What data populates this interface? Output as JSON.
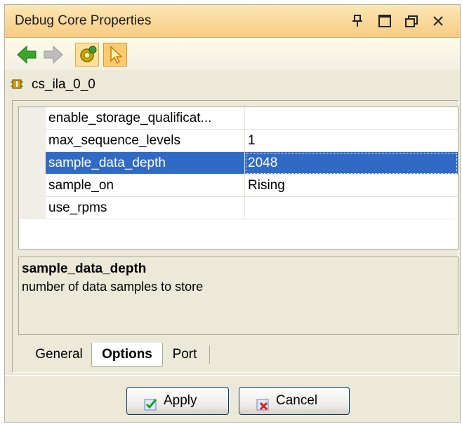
{
  "window": {
    "title": "Debug Core Properties"
  },
  "core": {
    "name": "cs_ila_0_0"
  },
  "properties": [
    {
      "name": "enable_storage_qualificat...",
      "value": "",
      "type": "checkbox",
      "checked": true
    },
    {
      "name": "max_sequence_levels",
      "value": "1",
      "type": "text"
    },
    {
      "name": "sample_data_depth",
      "value": "2048",
      "type": "text",
      "selected": true
    },
    {
      "name": "sample_on",
      "value": "Rising",
      "type": "text"
    },
    {
      "name": "use_rpms",
      "value": "",
      "type": "checkbox",
      "checked": false
    }
  ],
  "description": {
    "title": "sample_data_depth",
    "text": "number of data samples to store"
  },
  "tabs": [
    {
      "label": "General",
      "active": false
    },
    {
      "label": "Options",
      "active": true
    },
    {
      "label": "Port",
      "active": false
    }
  ],
  "buttons": {
    "apply": "Apply",
    "cancel": "Cancel"
  },
  "colors": {
    "title_bar": "#f7cb82",
    "selection": "#316ac5",
    "panel": "#ece9d8"
  }
}
